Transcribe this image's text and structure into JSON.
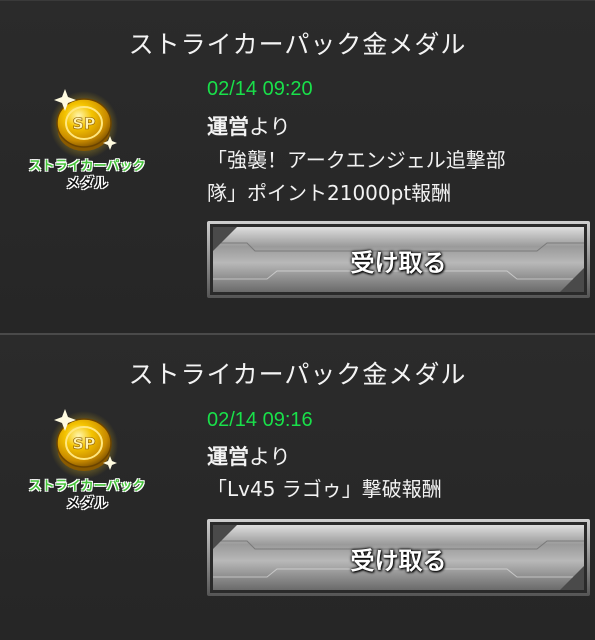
{
  "messages": [
    {
      "title": "ストライカーパック金メダル",
      "timestamp": "02/14 09:20",
      "sender_bold": "運営",
      "sender_rest": "より",
      "body_line1": "「強襲！アークエンジェル追撃部",
      "body_line2": "隊」ポイント21000pt報酬",
      "button_label": "受け取る",
      "icon": {
        "name": "gold-medal-icon",
        "line1": "ストライカーパック",
        "line2": "メダル"
      }
    },
    {
      "title": "ストライカーパック金メダル",
      "timestamp": "02/14 09:16",
      "sender_bold": "運営",
      "sender_rest": "より",
      "body_line1": "「Lv45 ラゴゥ」撃破報酬",
      "body_line2": "",
      "button_label": "受け取る",
      "icon": {
        "name": "gold-medal-icon",
        "line1": "ストライカーパック",
        "line2": "メダル"
      }
    }
  ],
  "colors": {
    "timestamp": "#19e04a",
    "background": "#2b2b2b",
    "medal_gold": "#f0b400",
    "medal_text_green": "#3fbf3a"
  }
}
